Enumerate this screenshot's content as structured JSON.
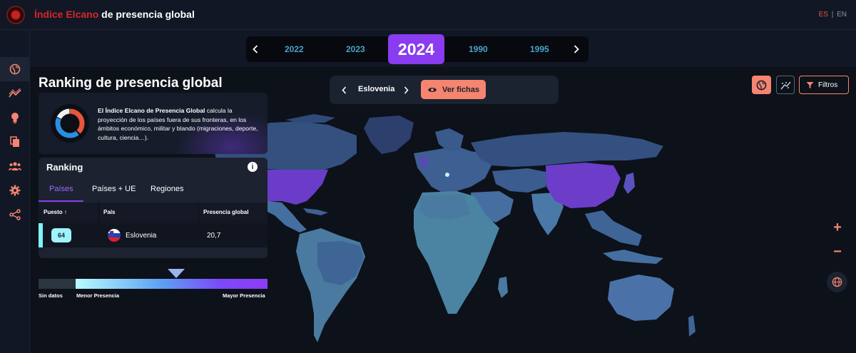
{
  "header": {
    "brand_red": "Índice Elcano",
    "brand_white": "de presencia global",
    "lang_active": "ES",
    "lang_sep": "|",
    "lang_other": "EN"
  },
  "sidebar": {
    "items": [
      {
        "icon": "globe-icon",
        "active": true
      },
      {
        "icon": "trend-icon",
        "active": false
      },
      {
        "icon": "lightbulb-icon",
        "active": false
      },
      {
        "icon": "documents-icon",
        "active": false
      },
      {
        "icon": "group-icon",
        "active": false
      },
      {
        "icon": "gear-icon",
        "active": false
      },
      {
        "icon": "share-icon",
        "active": false
      }
    ]
  },
  "years": {
    "items": [
      "2022",
      "2023",
      "1990",
      "1995"
    ],
    "active": "2024"
  },
  "main": {
    "title": "Ranking de presencia global",
    "info_bold": "El Índice Elcano de Presencia Global",
    "info_text": " calcula la proyección de los países fuera de sus fronteras, en los ámbitos económico, militar y blando (migraciones, deporte, cultura, ciencia…)."
  },
  "ranking": {
    "title": "Ranking",
    "info_glyph": "i",
    "tabs": [
      "Países",
      "Países + UE",
      "Regiones"
    ],
    "columns": [
      "Puesto",
      "País",
      "Presencia global"
    ],
    "sort_glyph": "↑",
    "rows": [
      {
        "rank": "64",
        "country": "Eslovenia",
        "score": "20,7"
      }
    ]
  },
  "legend": {
    "no_data": "Sin datos",
    "min": "Menor Presencia",
    "max": "Mayor Presencia"
  },
  "country_selector": {
    "name": "Eslovenia",
    "button_label": "Ver fichas"
  },
  "toolbar": {
    "filter_label": "Filtros"
  },
  "zoom": {
    "plus": "+",
    "minus": "−"
  },
  "colors": {
    "accent_purple": "#8a3cf0",
    "accent_coral": "#f58470",
    "brand_red": "#d92626"
  }
}
